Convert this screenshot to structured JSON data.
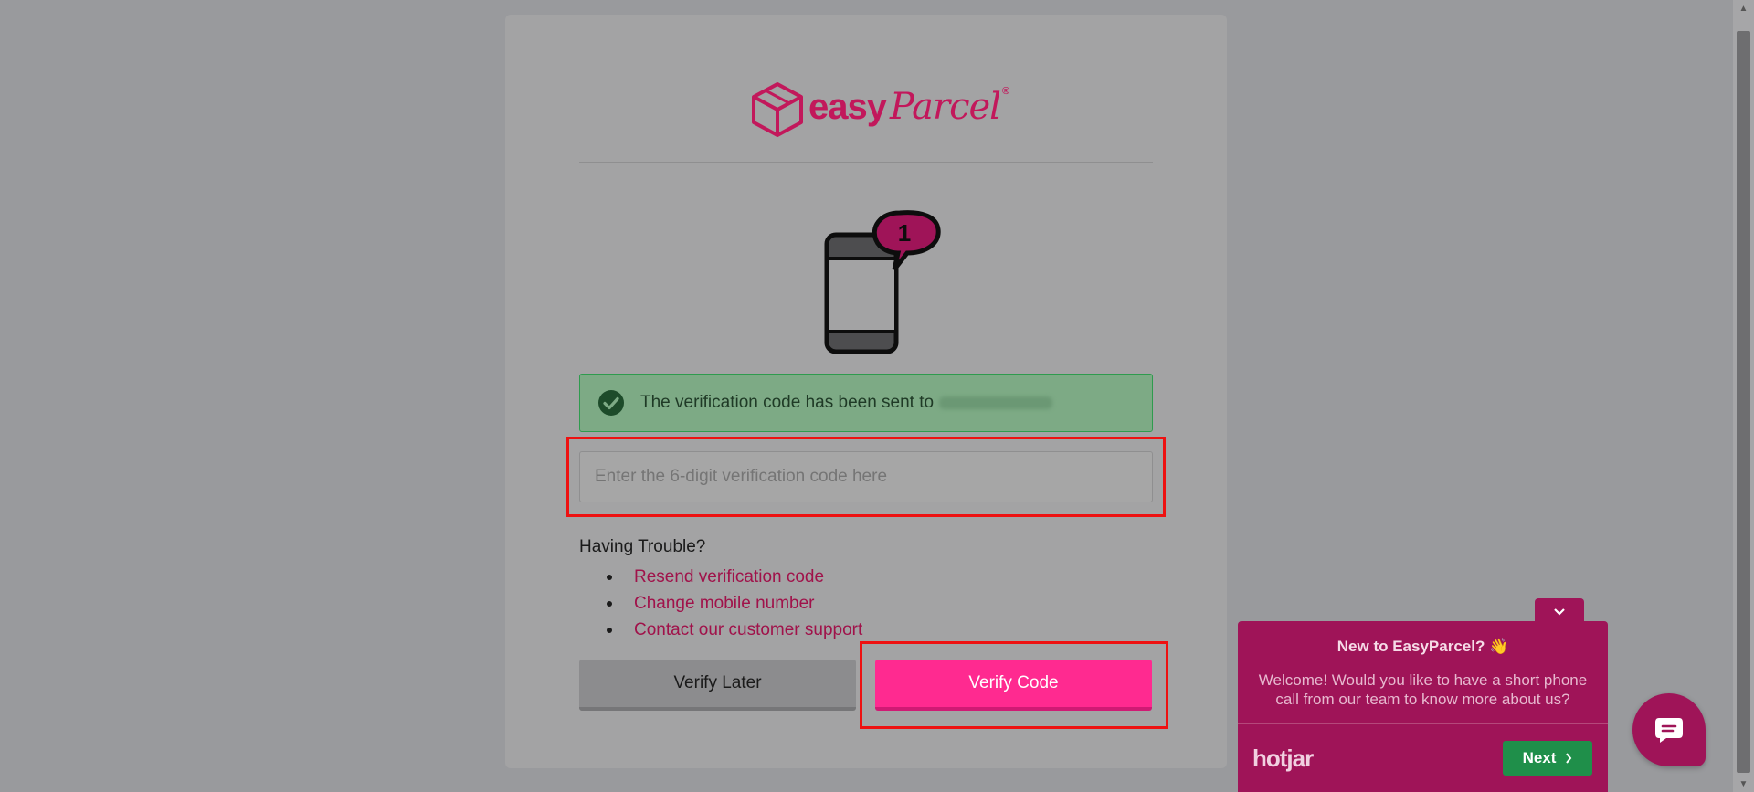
{
  "logo": {
    "brand_bold": "easy",
    "brand_script": "Parcel",
    "registered": "®"
  },
  "illustration": {
    "badge_count": "1"
  },
  "alert": {
    "message": "The verification code has been sent to"
  },
  "verify_input": {
    "placeholder": "Enter the 6-digit verification code here",
    "value": ""
  },
  "trouble": {
    "heading": "Having Trouble?",
    "links": [
      "Resend verification code",
      "Change mobile number",
      "Contact our customer support"
    ]
  },
  "buttons": {
    "later_label": "Verify Later",
    "verify_label": "Verify Code"
  },
  "hotjar": {
    "title": "New to EasyParcel? 👋",
    "message": "Welcome! Would you like to have a short phone call from our team to know more about us?",
    "brand": "hotjar",
    "next_label": "Next"
  },
  "colors": {
    "brand": "#c2185b",
    "primary_button": "#ff2a90",
    "success": "#2f9b4e",
    "highlight": "#ee1111"
  }
}
